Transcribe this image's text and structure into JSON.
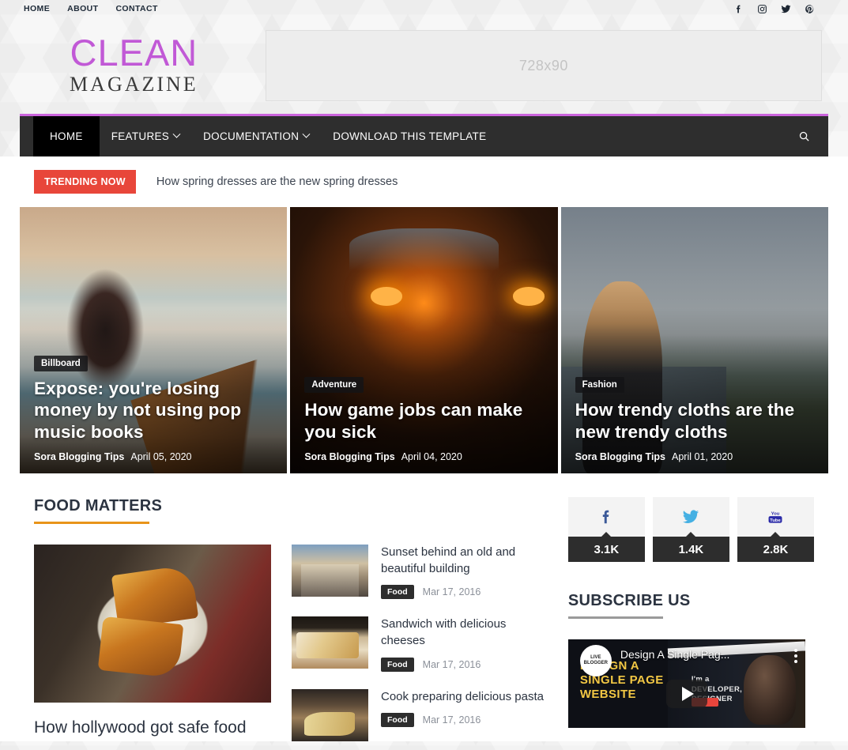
{
  "topbar": {
    "nav": [
      {
        "label": "HOME"
      },
      {
        "label": "ABOUT"
      },
      {
        "label": "CONTACT"
      }
    ],
    "social": [
      {
        "name": "facebook-icon"
      },
      {
        "name": "instagram-icon"
      },
      {
        "name": "twitter-icon"
      },
      {
        "name": "pinterest-icon"
      }
    ]
  },
  "header": {
    "logo_main": "CLEAN",
    "logo_sub": "MAGAZINE",
    "logo_color": "#c159d6",
    "ad_placeholder": "728x90"
  },
  "mainnav": {
    "accent_color": "#cb64dd",
    "items": [
      {
        "label": "HOME",
        "active": true,
        "caret": false
      },
      {
        "label": "FEATURES",
        "active": false,
        "caret": true
      },
      {
        "label": "DOCUMENTATION",
        "active": false,
        "caret": true
      },
      {
        "label": "DOWNLOAD THIS TEMPLATE",
        "active": false,
        "caret": false
      }
    ],
    "search_icon": "search-icon"
  },
  "trending": {
    "badge": "TRENDING NOW",
    "badge_color": "#e8463a",
    "headline": "How spring dresses are the new spring dresses"
  },
  "hero": [
    {
      "category": "Billboard",
      "title": "Expose: you're losing money by not using pop music books",
      "author": "Sora Blogging Tips",
      "date": "April 05, 2020",
      "art": "img-guitar"
    },
    {
      "category": "Adventure",
      "title": "How game jobs can make you sick",
      "author": "Sora Blogging Tips",
      "date": "April 04, 2020",
      "art": "img-robot"
    },
    {
      "category": "Fashion",
      "title": "How trendy cloths are the new trendy cloths",
      "author": "Sora Blogging Tips",
      "date": "April 01, 2020",
      "art": "img-shore"
    }
  ],
  "food_section": {
    "title": "FOOD MATTERS",
    "rule_color": "#e8941a",
    "feature": {
      "title": "How hollywood got safe food"
    },
    "posts": [
      {
        "title": "Sunset behind an old and beautiful building",
        "tag": "Food",
        "date": "Mar 17, 2016",
        "art": "pt-building"
      },
      {
        "title": "Sandwich with delicious cheeses",
        "tag": "Food",
        "date": "Mar 17, 2016",
        "art": "pt-sandwich"
      },
      {
        "title": "Cook preparing delicious pasta",
        "tag": "Food",
        "date": "Mar 17, 2016",
        "art": "pt-pasta"
      }
    ]
  },
  "sidebar": {
    "social_counts": [
      {
        "network": "facebook-icon",
        "count": "3.1K"
      },
      {
        "network": "twitter-icon",
        "count": "1.4K"
      },
      {
        "network": "youtube-icon",
        "count": "2.8K"
      }
    ],
    "subscribe": {
      "title": "SUBSCRIBE US",
      "rule_color": "#9a9a9a"
    },
    "video": {
      "title": "Design A Single Pag...",
      "thumb_line1": "DESIGN A",
      "thumb_line2": "SINGLE PAGE",
      "thumb_line3": "WEBSITE",
      "overlay_text1": "I'm a",
      "overlay_text2": "DEVELOPER,",
      "overlay_text3": "DESIGNER",
      "channel_badge": "LIVE BLOGGER",
      "play_icon": "play-icon"
    }
  }
}
